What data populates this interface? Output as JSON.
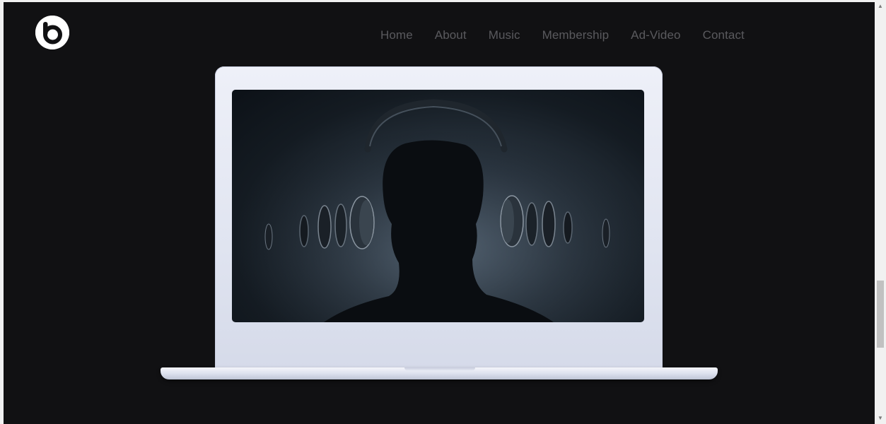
{
  "brand": {
    "logo_icon": "beats-logo-icon"
  },
  "nav": {
    "items": [
      {
        "label": "Home"
      },
      {
        "label": "About"
      },
      {
        "label": "Music"
      },
      {
        "label": "Membership"
      },
      {
        "label": "Ad-Video"
      },
      {
        "label": "Contact"
      }
    ]
  },
  "hero": {
    "device": "laptop-mockup",
    "screen_image": "man-with-exploded-headphones-image"
  },
  "colors": {
    "background": "#111113",
    "nav_text": "#5a5a5e",
    "laptop_body": "#e1e5f1"
  },
  "scroll": {
    "position_fraction": 0.72
  }
}
